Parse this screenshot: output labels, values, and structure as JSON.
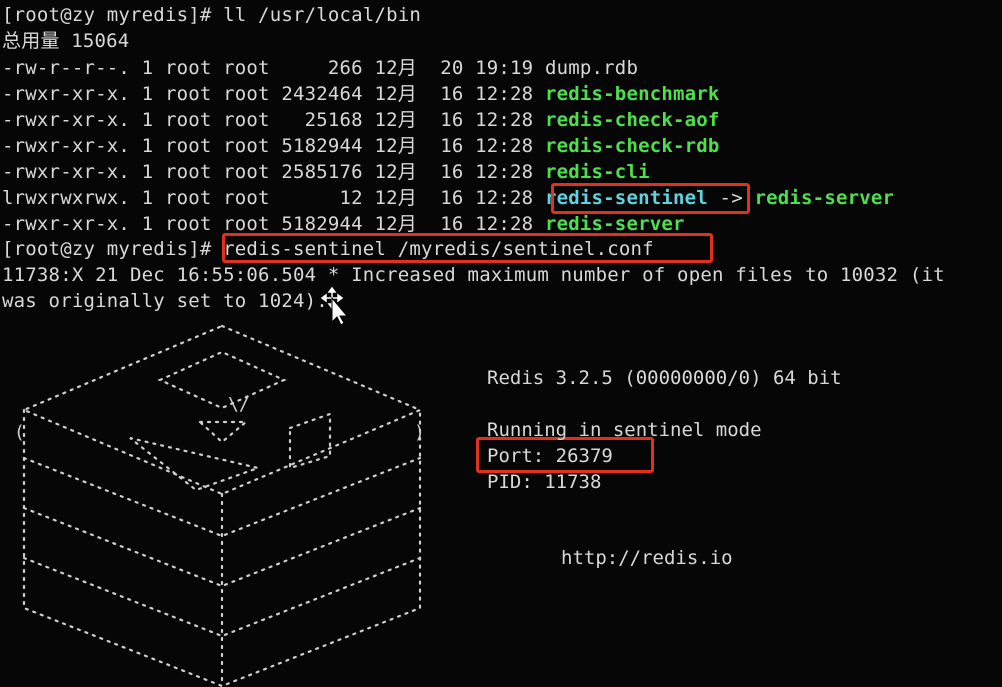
{
  "terminal": {
    "lines": [
      {
        "text": "[root@zy myredis]# ll /usr/local/bin"
      },
      {
        "text": "总用量 15064"
      },
      {
        "text": "-rw-r--r--. 1 root root     266 12月  20 19:19 ",
        "name": "dump.rdb",
        "color": "default"
      },
      {
        "text": "-rwxr-xr-x. 1 root root 2432464 12月  16 12:28 ",
        "name": "redis-benchmark",
        "color": "green"
      },
      {
        "text": "-rwxr-xr-x. 1 root root   25168 12月  16 12:28 ",
        "name": "redis-check-aof",
        "color": "green"
      },
      {
        "text": "-rwxr-xr-x. 1 root root 5182944 12月  16 12:28 ",
        "name": "redis-check-rdb",
        "color": "green"
      },
      {
        "text": "-rwxr-xr-x. 1 root root 2585176 12月  16 12:28 ",
        "name": "redis-cli",
        "color": "green"
      },
      {
        "text": "lrwxrwxrwx. 1 root root      12 12月  16 12:28 ",
        "name": "redis-sentinel",
        "color": "cyan",
        "link": " -> ",
        "target": "redis-server"
      },
      {
        "text": "-rwxr-xr-x. 1 root root 5182944 12月  16 12:28 ",
        "name": "redis-server",
        "color": "green"
      },
      {
        "text": "[root@zy myredis]# ",
        "command": "redis-sentinel /myredis/sentinel.conf"
      },
      {
        "text": "11738:X 21 Dec 16:55:06.504 * Increased maximum number of open files to 10032 (it"
      },
      {
        "text": "was originally set to 1024)."
      }
    ]
  },
  "banner": {
    "version": "Redis 3.2.5 (00000000/0) 64 bit",
    "mode": "Running in sentinel mode",
    "port": "Port: 26379",
    "pid": "PID: 11738",
    "url": "http://redis.io"
  },
  "colors": {
    "green": "#4de04d",
    "cyan": "#5fd3e0",
    "highlight": "#e03020",
    "background": "#060606"
  },
  "icons": {
    "cursor": "move-cursor-icon"
  }
}
